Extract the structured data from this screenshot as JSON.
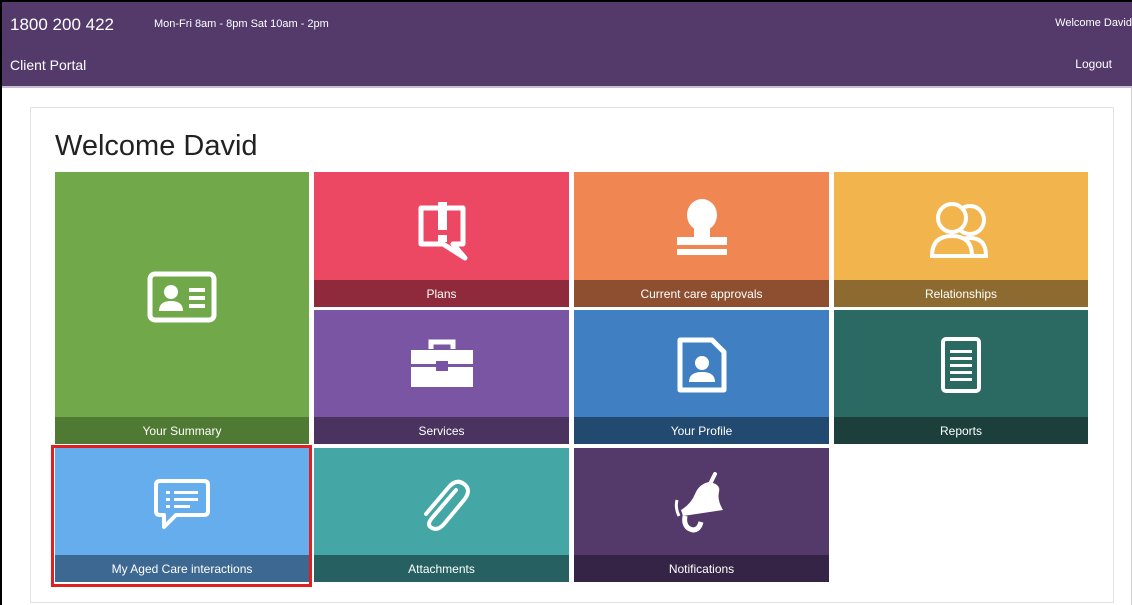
{
  "header": {
    "phone": "1800 200 422",
    "hours": "Mon-Fri 8am - 8pm Sat 10am - 2pm",
    "welcome": "Welcome David",
    "portal_title": "Client Portal",
    "logout": "Logout"
  },
  "main": {
    "heading": "Welcome David"
  },
  "tiles": {
    "summary": "Your Summary",
    "plans": "Plans",
    "approvals": "Current care approvals",
    "relationships": "Relationships",
    "services": "Services",
    "profile": "Your Profile",
    "reports": "Reports",
    "interactions": "My Aged Care interactions",
    "attachments": "Attachments",
    "notifications": "Notifications"
  },
  "colors": {
    "header": "#533a6b",
    "summary": "#71a849",
    "plans": "#ec4863",
    "approvals": "#f08651",
    "relationships": "#f2b54e",
    "services": "#7a55a4",
    "profile": "#3f7fc2",
    "reports": "#2b6963",
    "interactions": "#66adee",
    "attachments": "#45a6a6",
    "notifications": "#533a6b",
    "highlight": "#e02020"
  },
  "icons": {
    "summary": "id-card-icon",
    "plans": "exclamation-speech-icon",
    "approvals": "stamp-icon",
    "relationships": "users-icon",
    "services": "briefcase-icon",
    "profile": "profile-document-icon",
    "reports": "report-document-icon",
    "interactions": "chat-bubble-icon",
    "attachments": "paperclip-icon",
    "notifications": "bell-icon"
  }
}
